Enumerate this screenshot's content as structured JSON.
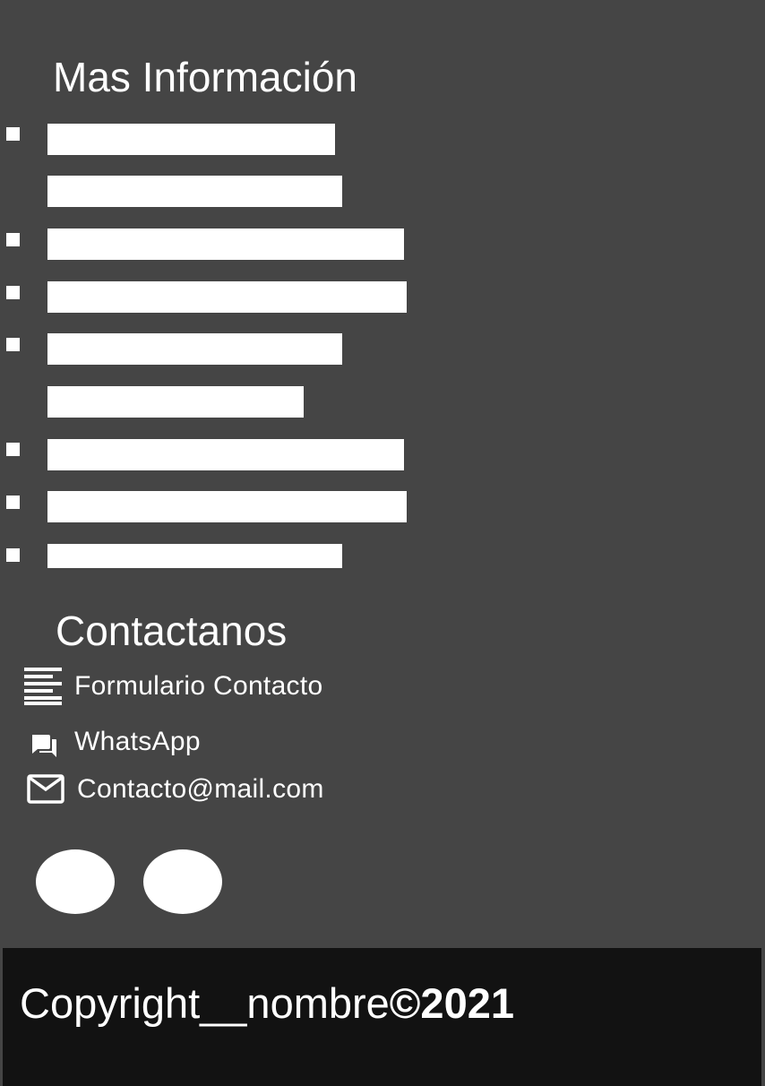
{
  "info": {
    "title": "Mas Información",
    "items": [
      {
        "bullet": true
      },
      {
        "bullet": false
      },
      {
        "bullet": true
      },
      {
        "bullet": true
      },
      {
        "bullet": true
      },
      {
        "bullet": false
      },
      {
        "bullet": true
      },
      {
        "bullet": true
      },
      {
        "bullet": true
      }
    ]
  },
  "contact": {
    "title": "Contactanos",
    "form_label": "Formulario Contacto",
    "form_icon": "form-lines-icon",
    "whatsapp_label": "WhatsApp",
    "whatsapp_icon": "chat-icon",
    "email_label": "Contacto@mail.com",
    "email_icon": "mail-icon"
  },
  "social": [
    {
      "icon": "social-icon-1"
    },
    {
      "icon": "social-icon-2"
    }
  ],
  "footer": {
    "copyright_prefix": "Copyright__nombre",
    "copyright_year": "©2021"
  },
  "colors": {
    "background": "#454545",
    "footer_background": "#121212",
    "foreground": "#ffffff"
  }
}
